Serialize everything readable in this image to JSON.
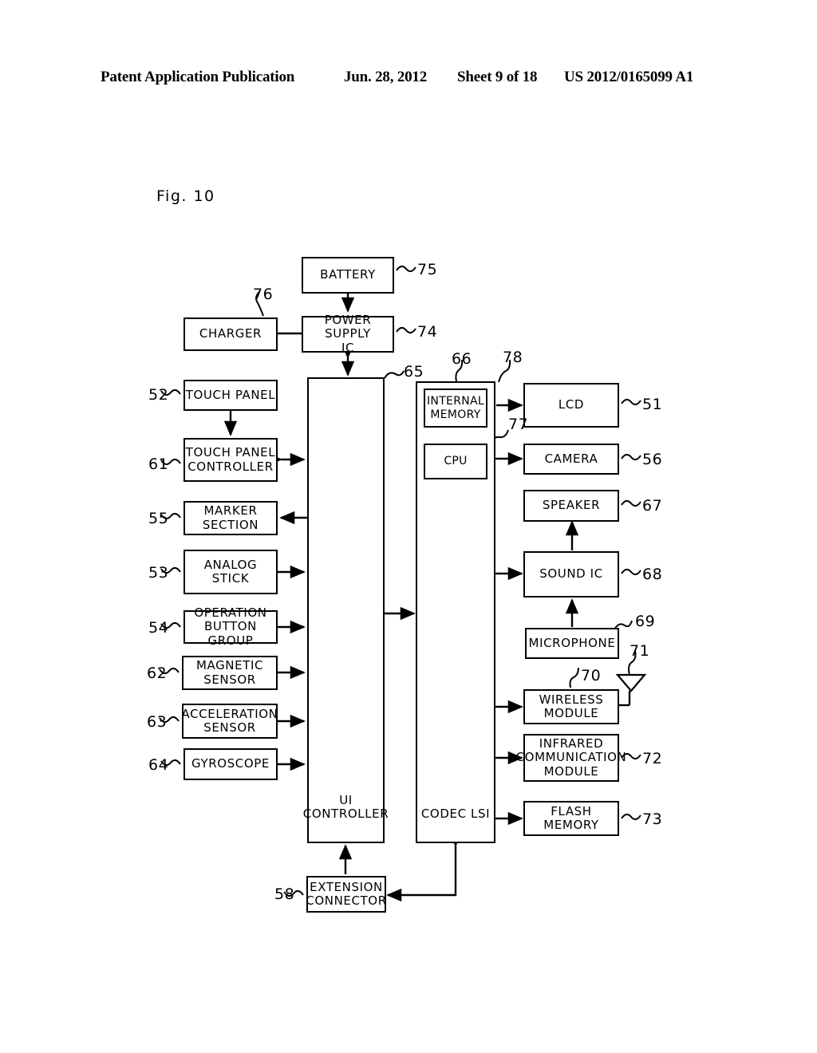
{
  "header": {
    "publication": "Patent Application Publication",
    "date": "Jun. 28, 2012",
    "sheet": "Sheet 9 of 18",
    "patent_number": "US 2012/0165099 A1"
  },
  "figure": {
    "label": "Fig. 10",
    "title": "Fig. 10"
  },
  "blocks": {
    "battery": "BATTERY",
    "charger": "CHARGER",
    "power_supply_ic": "POWER SUPPLY\nIC",
    "touch_panel": "TOUCH PANEL",
    "touch_panel_controller": "TOUCH PANEL\nCONTROLLER",
    "marker_section": "MARKER\nSECTION",
    "analog_stick": "ANALOG STICK",
    "operation_button_group": "OPERATION\nBUTTON GROUP",
    "magnetic_sensor": "MAGNETIC\nSENSOR",
    "acceleration_sensor": "ACCELERATION\nSENSOR",
    "gyroscope": "GYROSCOPE",
    "ui_controller": "UI\nCONTROLLER",
    "codec_lsi": "CODEC LSI",
    "internal_memory": "INTERNAL\nMEMORY",
    "cpu": "CPU",
    "lcd": "LCD",
    "camera": "CAMERA",
    "speaker": "SPEAKER",
    "sound_ic": "SOUND IC",
    "microphone": "MICROPHONE",
    "wireless_module": "WIRELESS\nMODULE",
    "infrared_communication_module": "INFRARED\nCOMMUNICATION\nMODULE",
    "flash_memory": "FLASH MEMORY",
    "extension_connector": "EXTENSION\nCONNECTOR"
  },
  "reference_numerals": {
    "battery": "75",
    "charger": "76",
    "power_supply_ic": "74",
    "touch_panel": "52",
    "touch_panel_controller": "61",
    "marker_section": "55",
    "analog_stick": "53",
    "operation_button_group": "54",
    "magnetic_sensor": "62",
    "acceleration_sensor": "63",
    "gyroscope": "64",
    "ui_controller": "65",
    "codec_lsi": "66",
    "internal_memory": "78",
    "cpu": "77",
    "lcd": "51",
    "camera": "56",
    "speaker": "67",
    "sound_ic": "68",
    "microphone": "69",
    "wireless_module": "70",
    "antenna": "71",
    "infrared_communication_module": "72",
    "flash_memory": "73",
    "extension_connector": "58"
  },
  "icons": {
    "antenna": "antenna-triangle-symbol"
  },
  "colors": {
    "ink": "#000000",
    "paper": "#ffffff"
  }
}
